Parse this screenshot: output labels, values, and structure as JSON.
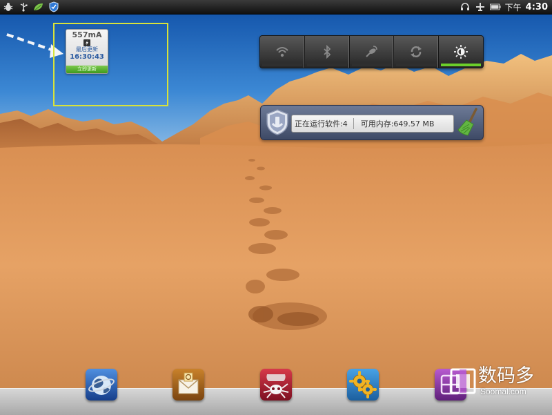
{
  "status_bar": {
    "left_icons": [
      "bug-icon",
      "usb-icon",
      "leaf-icon",
      "shield-icon"
    ],
    "right_icons": [
      "headset-icon",
      "airplane-icon",
      "battery-icon"
    ],
    "clock_label": "下午",
    "clock_time": "4:30"
  },
  "battery_widget": {
    "current": "557mA",
    "label": "最后更新",
    "time": "16:30:43",
    "refresh_label": "立即更新",
    "icon": "charging-bolt-icon",
    "highlight_color": "#d8e23a"
  },
  "power_control": {
    "toggles": [
      {
        "name": "wifi",
        "icon": "wifi-icon",
        "on": false
      },
      {
        "name": "bluetooth",
        "icon": "bluetooth-icon",
        "on": false
      },
      {
        "name": "gps",
        "icon": "gps-icon",
        "on": false
      },
      {
        "name": "sync",
        "icon": "sync-icon",
        "on": false
      },
      {
        "name": "brightness",
        "icon": "brightness-icon",
        "on": true
      }
    ],
    "on_color": "#6ccf2a"
  },
  "task_widget": {
    "running_label": "正在运行软件:4",
    "memory_label": "可用内存:649.57 MB",
    "icons": [
      "shield-icon",
      "broom-icon"
    ]
  },
  "dock": {
    "apps": [
      {
        "name": "browser",
        "icon": "globe-icon"
      },
      {
        "name": "email",
        "icon": "mail-icon"
      },
      {
        "name": "spider",
        "icon": "spider-icon"
      },
      {
        "name": "settings",
        "icon": "gears-icon"
      },
      {
        "name": "apps",
        "icon": "apps-icon"
      }
    ]
  },
  "watermark": {
    "title": "数码多",
    "url": "Soomal.com"
  }
}
